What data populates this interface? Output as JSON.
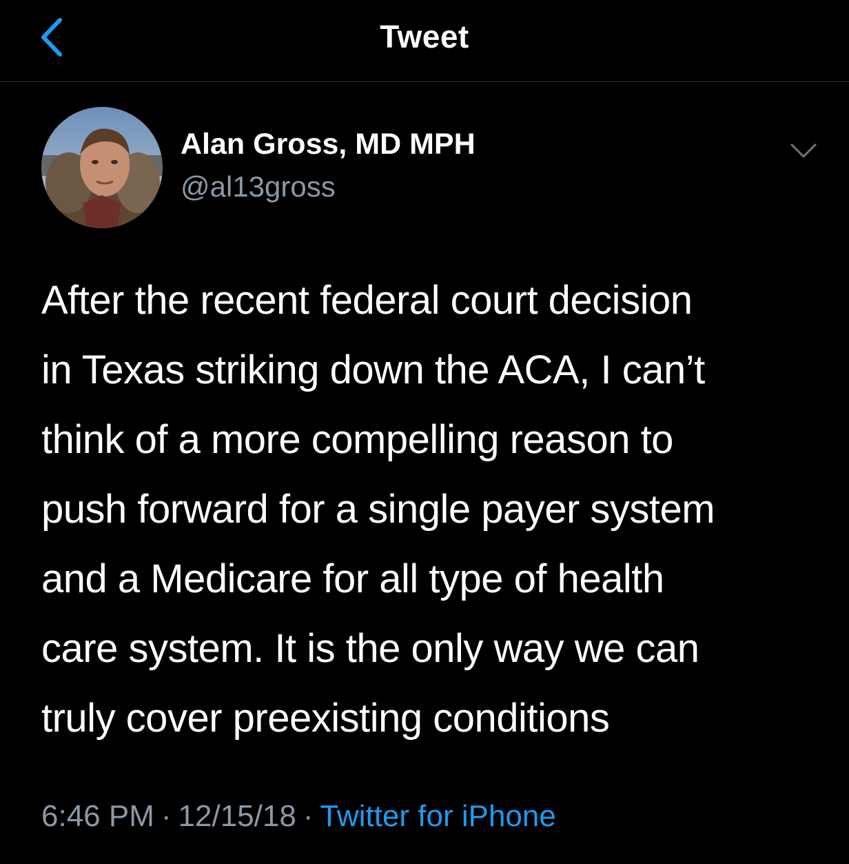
{
  "nav": {
    "title": "Tweet",
    "back_icon": "chevron-left-icon",
    "accent_color": "#1d9bf0"
  },
  "tweet": {
    "author": {
      "name": "Alan Gross, MD MPH",
      "handle": "@al13gross",
      "avatar_icon": "avatar-photo"
    },
    "menu_icon": "chevron-down-icon",
    "text_lines": [
      "After the recent federal court decision",
      "in Texas striking down the ACA, I can’t",
      "think of a more compelling reason to",
      "push forward for a single payer system",
      "and a Medicare for all type of health",
      "care system. It is the only way we can",
      "truly cover preexisting conditions"
    ],
    "time": "6:46 PM",
    "separator": "·",
    "date": "12/15/18",
    "source": "Twitter for iPhone"
  },
  "colors": {
    "background": "#000000",
    "text_primary": "#ffffff",
    "text_secondary": "#8b98a5",
    "link": "#1d9bf0",
    "divider": "#2f3336"
  }
}
